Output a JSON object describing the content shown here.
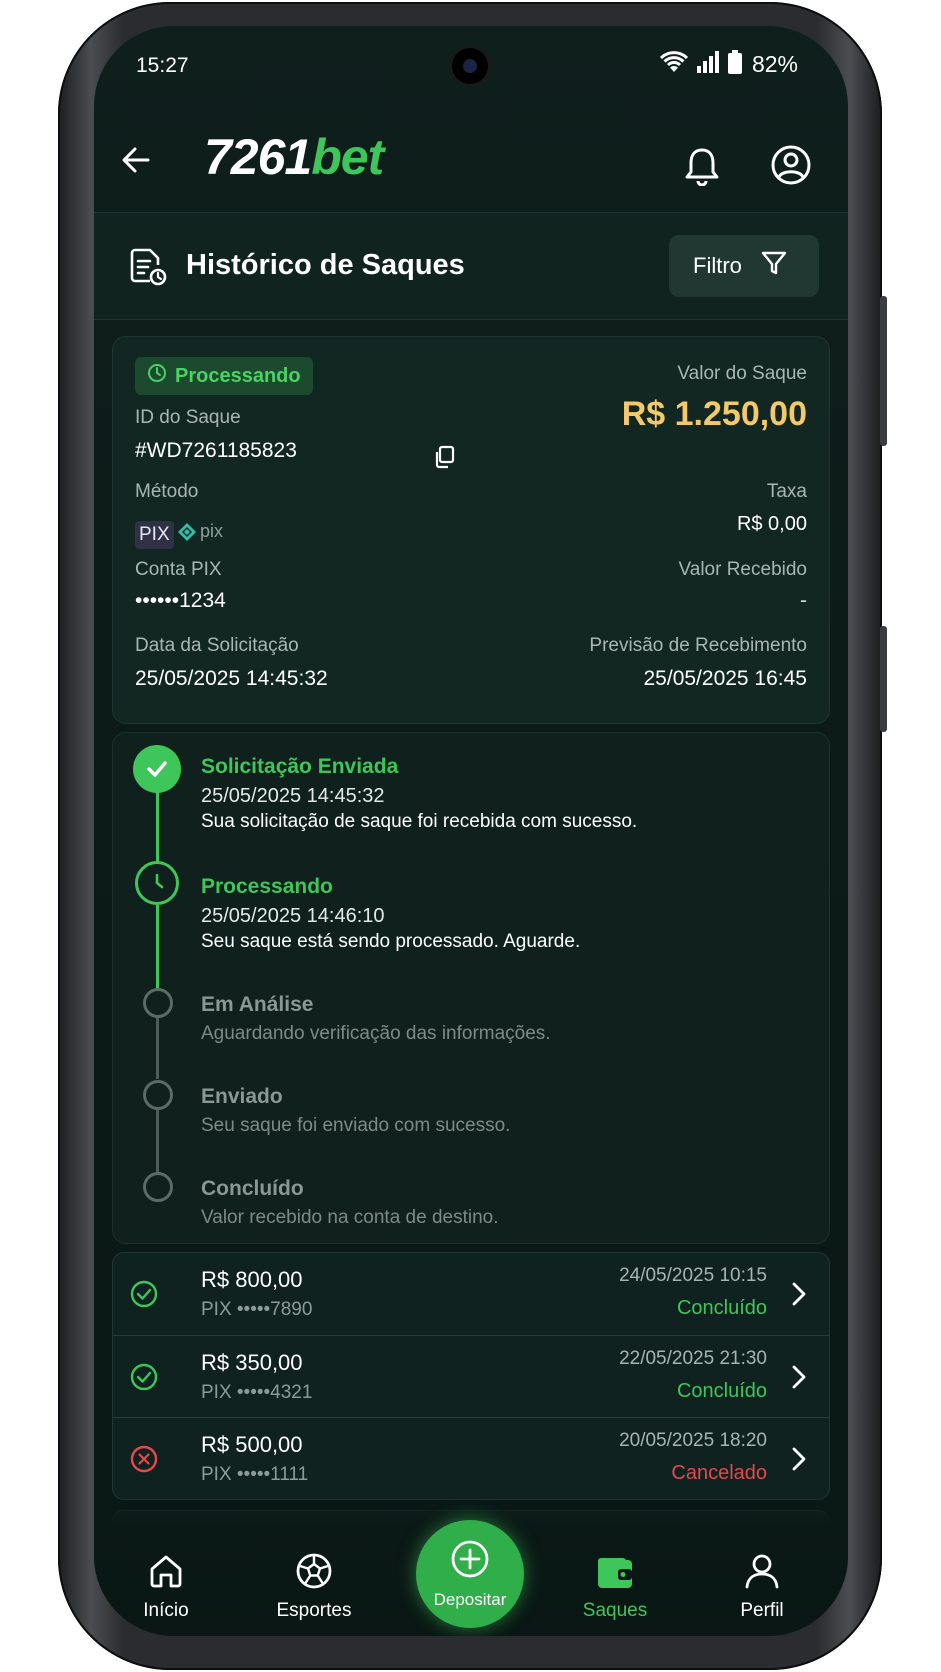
{
  "status_bar": {
    "time": "15:27",
    "battery": "82%"
  },
  "header": {
    "logo_number": "7261",
    "logo_suffix": "bet"
  },
  "page": {
    "title": "Histórico de Saques",
    "filter_label": "Filtro"
  },
  "withdrawal": {
    "status": "Processando",
    "amount_label": "Valor do Saque",
    "amount": "R$ 1.250,00",
    "id_label": "ID do Saque",
    "id": "#WD7261185823",
    "method_label": "Método",
    "method": "PIX",
    "method_brand": "pix",
    "fee_label": "Taxa",
    "fee": "R$ 0,00",
    "account_label": "Conta PIX",
    "account": "••••••1234",
    "received_label": "Valor Recebido",
    "received": "-",
    "request_date_label": "Data da Solicitação",
    "request_date": "25/05/2025 14:45:32",
    "eta_label": "Previsão de Recebimento",
    "eta": "25/05/2025 16:45"
  },
  "timeline": [
    {
      "title": "Solicitação Enviada",
      "date": "25/05/2025 14:45:32",
      "text": "Sua solicitação de saque foi recebida com sucesso.",
      "state": "done"
    },
    {
      "title": "Processando",
      "date": "25/05/2025 14:46:10",
      "text": "Seu saque está sendo processado. Aguarde.",
      "state": "current"
    },
    {
      "title": "Em Análise",
      "text": "Aguardando verificação das informações.",
      "state": "pending"
    },
    {
      "title": "Enviado",
      "text": "Seu saque foi enviado com sucesso.",
      "state": "pending"
    },
    {
      "title": "Concluído",
      "text": "Valor recebido na conta de destino.",
      "state": "pending"
    }
  ],
  "history": [
    {
      "amount": "R$ 800,00",
      "account": "PIX •••••7890",
      "date": "24/05/2025 10:15",
      "status": "Concluído",
      "status_color": "#3ec65a"
    },
    {
      "amount": "R$ 350,00",
      "account": "PIX •••••4321",
      "date": "22/05/2025 21:30",
      "status": "Concluído",
      "status_color": "#3ec65a"
    },
    {
      "amount": "R$ 500,00",
      "account": "PIX •••••1111",
      "date": "20/05/2025 18:20",
      "status": "Cancelado",
      "status_color": "#e5484d"
    }
  ],
  "nav": {
    "inicio": "Início",
    "esportes": "Esportes",
    "depositar": "Depositar",
    "saques": "Saques",
    "perfil": "Perfil"
  },
  "colors": {
    "accent": "#3ec65a",
    "amount": "#f3c969",
    "danger": "#e5484d",
    "background": "#0c1b18"
  }
}
